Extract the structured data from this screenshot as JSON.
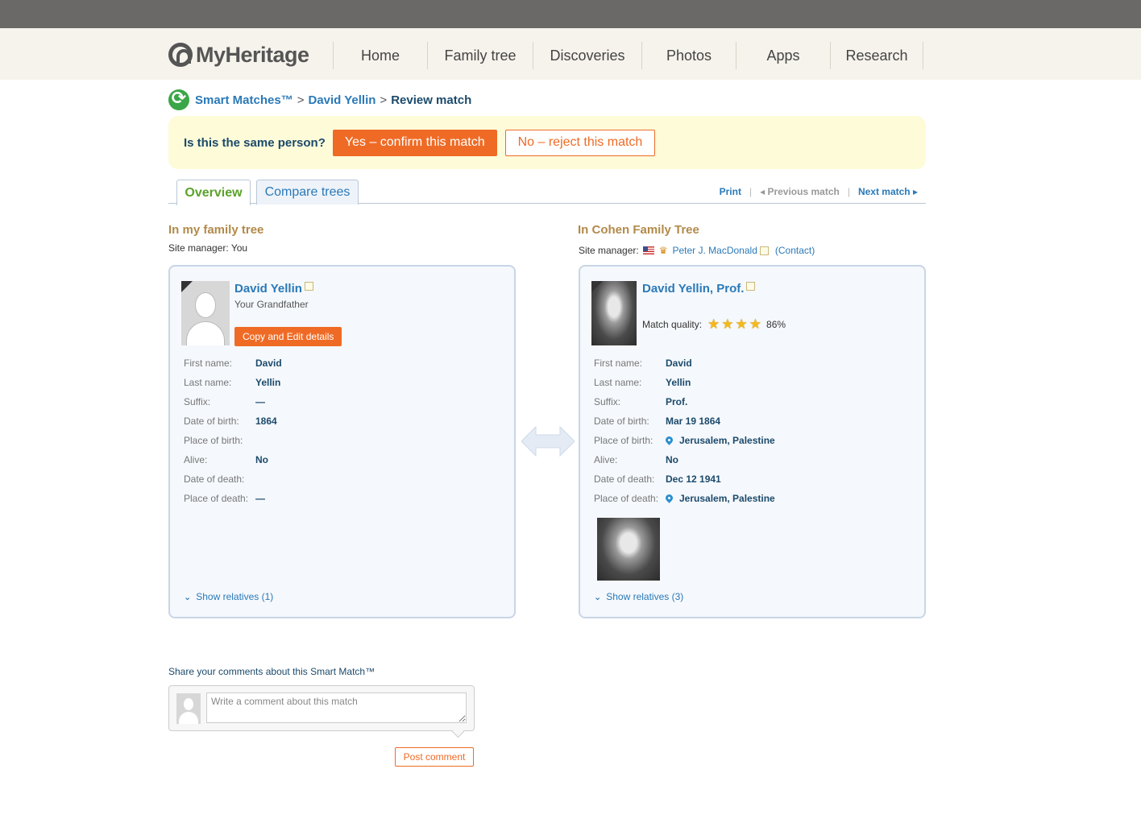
{
  "brand": {
    "logo_text": "MyHeritage"
  },
  "nav": {
    "items": [
      {
        "label": "Home"
      },
      {
        "label": "Family tree"
      },
      {
        "label": "Discoveries"
      },
      {
        "label": "Photos"
      },
      {
        "label": "Apps"
      },
      {
        "label": "Research"
      }
    ]
  },
  "breadcrumb": {
    "smart_matches": "Smart Matches™",
    "sep": ">",
    "person": "David Yellin",
    "current": "Review match"
  },
  "confirm": {
    "question": "Is this the same person?",
    "yes_label": "Yes – confirm this match",
    "no_label": "No – reject this match"
  },
  "tabs": {
    "overview": "Overview",
    "compare": "Compare trees"
  },
  "match_nav": {
    "print": "Print",
    "previous": "◂ Previous match",
    "next": "Next match ▸",
    "sep": "|"
  },
  "left": {
    "title": "In my family tree",
    "site_manager": "Site manager: You",
    "name": "David Yellin",
    "relation": "Your Grandfather",
    "copy_label": "Copy and Edit details",
    "fields": [
      {
        "label": "First name:",
        "value": "David"
      },
      {
        "label": "Last name:",
        "value": "Yellin"
      },
      {
        "label": "Suffix:",
        "value": "—"
      },
      {
        "label": "Date of birth:",
        "value": "1864"
      },
      {
        "label": "Place of birth:",
        "value": ""
      },
      {
        "label": "Alive:",
        "value": "No"
      },
      {
        "label": "Date of death:",
        "value": ""
      },
      {
        "label": "Place of death:",
        "value": "—"
      }
    ],
    "show_relatives": "Show relatives (1)"
  },
  "right": {
    "title": "In Cohen Family Tree",
    "site_manager_label": "Site manager:",
    "manager_name": "Peter J. MacDonald",
    "contact": "(Contact)",
    "name": "David Yellin, Prof.",
    "match_quality_label": "Match quality:",
    "match_stars": 4,
    "match_percent": "86%",
    "fields": [
      {
        "label": "First name:",
        "value": "David"
      },
      {
        "label": "Last name:",
        "value": "Yellin"
      },
      {
        "label": "Suffix:",
        "value": "Prof."
      },
      {
        "label": "Date of birth:",
        "value": "Mar 19 1864"
      },
      {
        "label": "Place of birth:",
        "value": "Jerusalem, Palestine"
      },
      {
        "label": "Alive:",
        "value": "No"
      },
      {
        "label": "Date of death:",
        "value": "Dec 12 1941"
      },
      {
        "label": "Place of death:",
        "value": "Jerusalem, Palestine"
      }
    ],
    "show_relatives": "Show relatives (3)"
  },
  "comments": {
    "share_label": "Share your comments about this Smart Match™",
    "placeholder": "Write a comment about this match",
    "post_label": "Post comment"
  },
  "colors": {
    "accent_orange": "#ef6b25",
    "link_blue": "#2a79b8",
    "tab_green": "#5aa22a",
    "title_gold": "#b28a4a"
  }
}
